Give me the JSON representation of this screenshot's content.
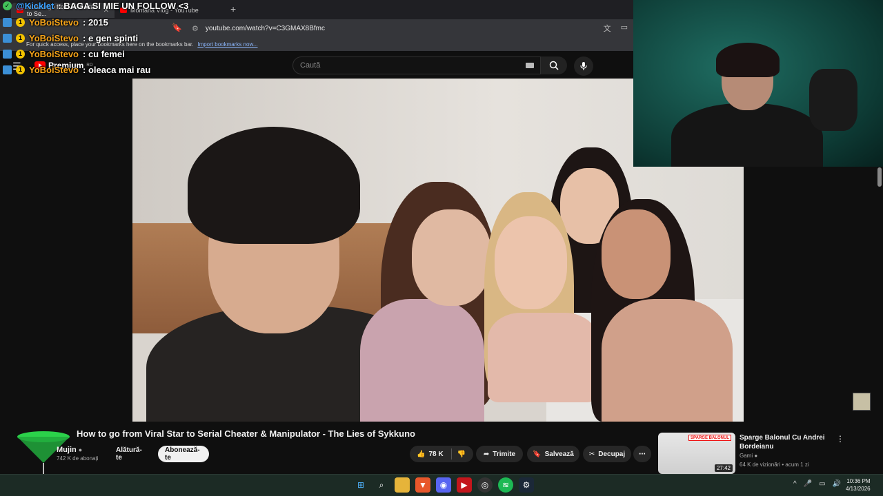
{
  "browser": {
    "tabs": [
      {
        "label": "How to go from Viral Star to Se...",
        "active": true
      },
      {
        "label": "Montana Vlog - YouTube",
        "active": false
      }
    ],
    "new_tab": "+",
    "url": "youtube.com/watch?v=C3GMAX8Bfmc",
    "bookmarks_hint": "For quick access, place your bookmarks here on the bookmarks bar.",
    "bookmarks_link": "Import bookmarks now..."
  },
  "yt": {
    "logo": "Premium",
    "logo_region": "RO",
    "search_placeholder": "Caută"
  },
  "chat": [
    {
      "user": "@Kicklet",
      "text": ": BAGA SI MIE UN FOLLOW <3",
      "badge": "",
      "user_color": "blue"
    },
    {
      "user": "YoBoiStevo",
      "text": ": 2015",
      "badge": "1",
      "user_color": "orange"
    },
    {
      "user": "YoBoiStevo",
      "text": ": e gen spinti",
      "badge": "1",
      "user_color": "orange"
    },
    {
      "user": "YoBoiStevo",
      "text": ": cu femei",
      "badge": "1",
      "user_color": "orange"
    },
    {
      "user": "YoBoiStevo",
      "text": ": oleaca mai rau",
      "badge": "1",
      "user_color": "orange"
    }
  ],
  "video": {
    "title": "How to go from Viral Star to Serial Cheater & Manipulator - The Lies of Sykkuno",
    "channel": "Mujin",
    "subscribers": "742 K de abonați",
    "join": "Alătură-te",
    "subscribe": "Abonează-te",
    "likes": "78 K",
    "share": "Trimite",
    "save": "Salvează",
    "clip": "Decupaj"
  },
  "recommendation": {
    "title": "Sparge Balonul Cu Andrei Bordeianu",
    "channel": "Gami",
    "meta": "64 K de vizionări • acum 1 zi",
    "duration": "27:42",
    "banner": "SPARGE BALONUL"
  },
  "taskbar": {
    "time": "10:36 PM",
    "date": "4/13/2026"
  },
  "colors": {
    "yt_red": "#ff0000",
    "chat_user_orange": "#f4a318",
    "chat_user_blue": "#3aa0ff",
    "badge_yellow": "#f2c200"
  }
}
